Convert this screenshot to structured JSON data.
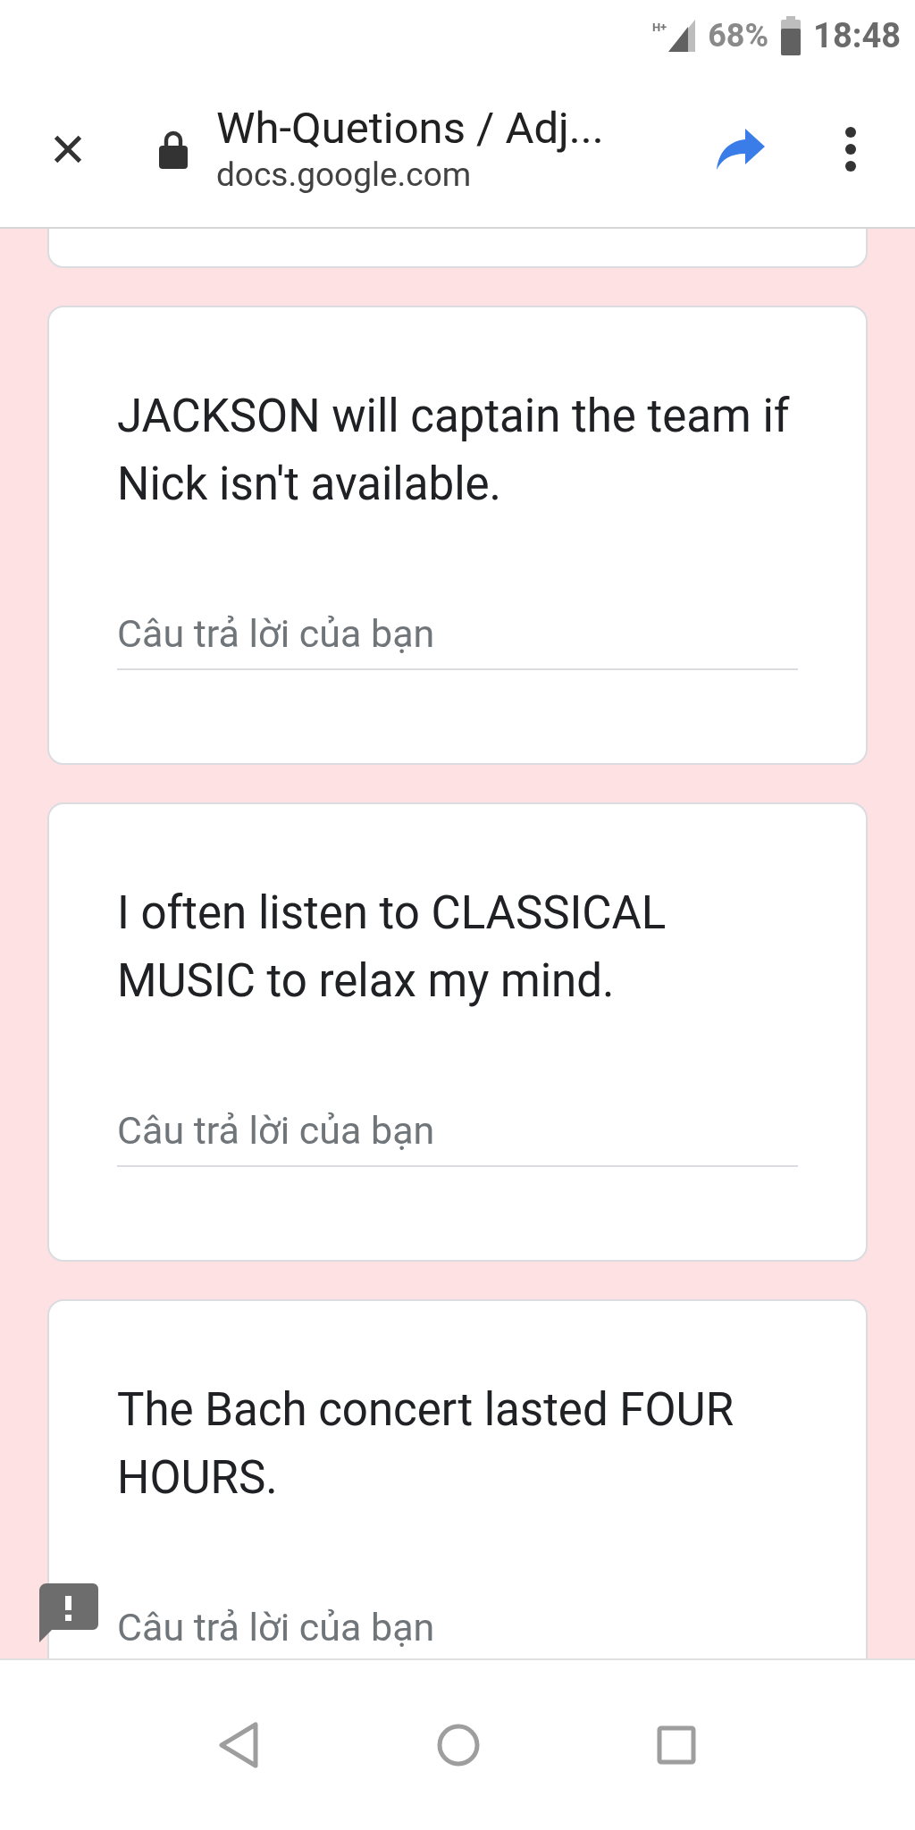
{
  "status_bar": {
    "network": "H+",
    "battery": "68%",
    "time": "18:48"
  },
  "toolbar": {
    "title": "Wh-Quetions / Adj...",
    "url": "docs.google.com"
  },
  "questions": [
    {
      "text": "JACKSON will captain the team if Nick isn't available.",
      "placeholder": "Câu trả lời của bạn"
    },
    {
      "text": "I often listen to CLASSICAL MUSIC to relax my mind.",
      "placeholder": "Câu trả lời của bạn"
    },
    {
      "text": "The Bach concert lasted FOUR HOURS.",
      "placeholder": "Câu trả lời của bạn"
    }
  ]
}
